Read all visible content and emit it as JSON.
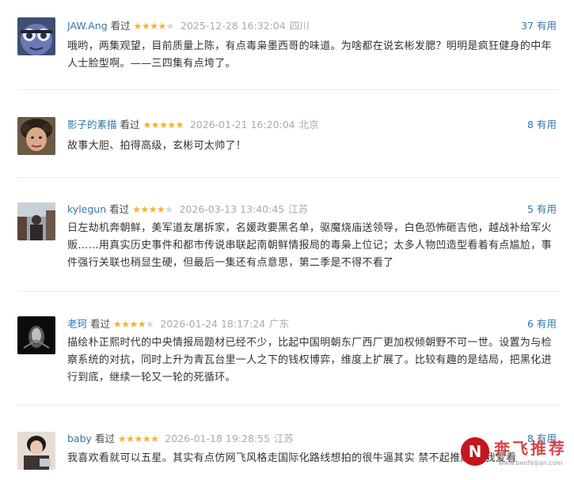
{
  "reviews": [
    {
      "user": "JAW.Ang",
      "status": "看过",
      "rating": 4,
      "time": "2025-12-28 16:32:04",
      "location": "四川",
      "votes": "37",
      "vote_label": "有用",
      "content": "哦哟，两集观望，目前质量上陈，有点毒枭墨西哥的味道。为啥都在说玄彬发腮？明明是疯狂健身的中年人士脸型啊。——三四集有点垮了。"
    },
    {
      "user": "影子的素描",
      "status": "看过",
      "rating": 5,
      "time": "2026-01-21 16:20:04",
      "location": "北京",
      "votes": "8",
      "vote_label": "有用",
      "content": "故事大胆、拍得高级，玄彬可太帅了！"
    },
    {
      "user": "kylegun",
      "status": "看过",
      "rating": 4,
      "time": "2026-03-13 13:40:45",
      "location": "江苏",
      "votes": "5",
      "vote_label": "有用",
      "content": "日左劫机奔朝鲜，美军道友屠拆家，名媛政要黑名单，驱魔烧庙送领导，白色恐怖砸吉他，越战补给军火贩……用真实历史事件和都市传说串联起南朝鲜情报局的毒枭上位记；太多人物凹造型看着有点尴尬，事件强行关联也稍显生硬，但最后一集还有点意思，第二季是不得不看了"
    },
    {
      "user": "老珂",
      "status": "看过",
      "rating": 4,
      "time": "2026-01-24 18:17:24",
      "location": "广东",
      "votes": "6",
      "vote_label": "有用",
      "content": "描绘朴正熙时代的中央情报局题材已经不少，比起中国明朝东厂西厂更加权倾朝野不可一世。设置为与检察系统的对抗，同时上升为青瓦台里一人之下的钱权博弈，维度上扩展了。比较有趣的是结局，把黑化进行到底，继续一轮又一轮的死循环。"
    },
    {
      "user": "baby",
      "status": "看过",
      "rating": 5,
      "time": "2026-01-18 19:28:55",
      "location": "江苏",
      "votes": "8",
      "vote_label": "有用",
      "content": "我喜欢看就可以五星。其实有点仿网飞风格走国际化路线想拍的很牛逼其实 禁不起推敲 但我爱看"
    }
  ],
  "watermark": {
    "brand": "奔飞推荐",
    "url": "www.benfeijian.com"
  },
  "colors": {
    "link": "#3377aa",
    "star_on": "#f4b12f",
    "star_off": "#d6d6d6",
    "meta_gray": "#aaaaaa",
    "text": "#333333"
  }
}
